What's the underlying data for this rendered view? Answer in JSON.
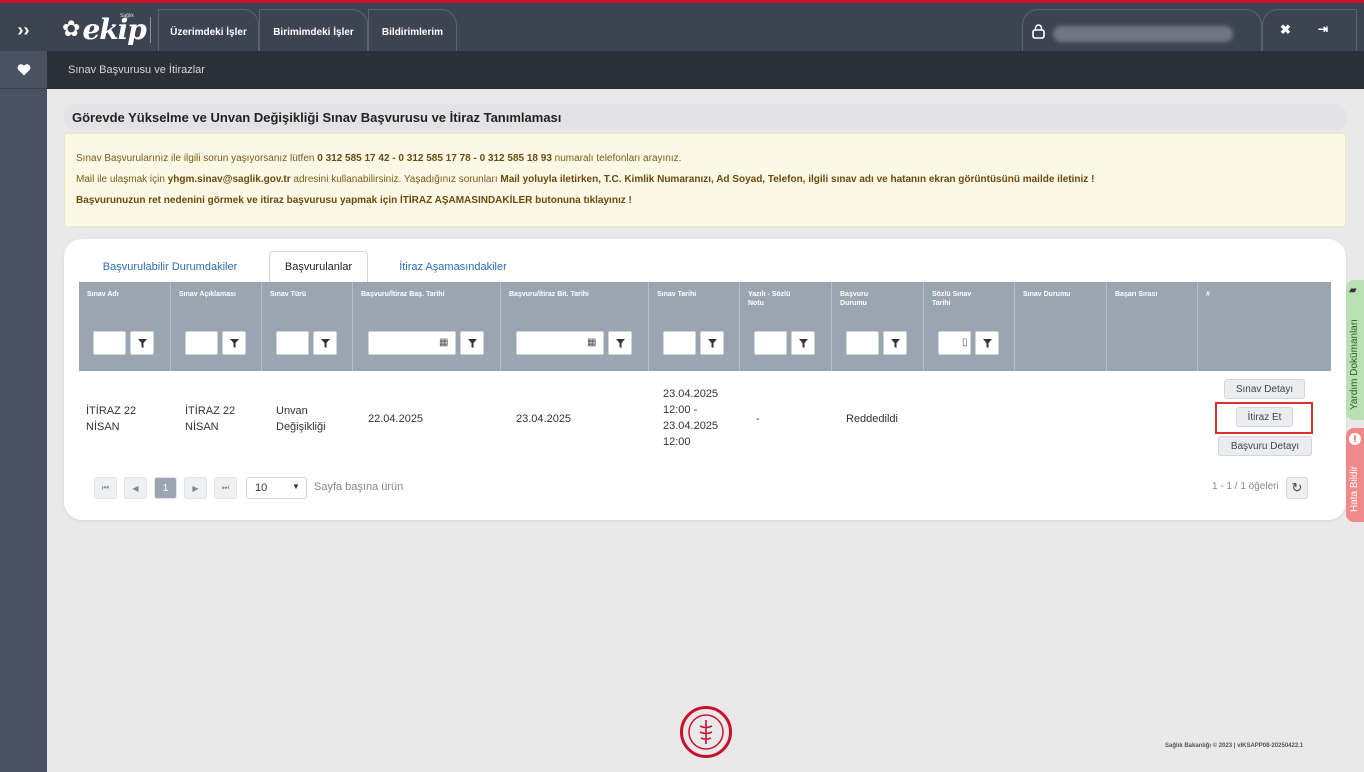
{
  "topbar": {
    "logo_text": "ekip",
    "logo_sub": "Sağlık",
    "tabs": [
      "Üzerimdeki İşler",
      "Birimimdeki İşler",
      "Bildirimlerim"
    ]
  },
  "breadcrumb": "Sınav Başvurusu ve İtirazlar",
  "page_title": "Görevde Yükselme ve Unvan Değişikliği Sınav Başvurusu ve İtiraz Tanımlaması",
  "info": {
    "line1_pre": "Sınav Başvurularınız ile ilgili sorun yaşıyorsanız lütfen ",
    "line1_bold": "0 312 585 17 42 - 0 312 585 17 78 - 0 312 585 18 93",
    "line1_post": " numaralı telefonları arayınız.",
    "line2_pre": "Mail ile ulaşmak için ",
    "line2_mail": "yhgm.sinav@saglik.gov.tr",
    "line2_mid": " adresini kullanabilirsiniz. Yaşadığınız sorunları ",
    "line2_bold": "Mail yoluyla iletirken, T.C. Kimlik Numaranızı, Ad Soyad, Telefon, ilgili sınav adı ve hatanın ekran görüntüsünü mailde iletiniz !",
    "line3": "Başvurunuzun ret nedenini görmek ve itiraz başvurusu yapmak için İTİRAZ AŞAMASINDAKİLER butonuna tıklayınız !"
  },
  "tabs": [
    "Başvurulabilir Durumdakiler",
    "Başvurulanlar",
    "İtiraz Aşamasındakiler"
  ],
  "columns": [
    "Sınav Adı",
    "Sınav Açıklaması",
    "Sınav Türü",
    "Başvuru/İtiraz Baş. Tarihi",
    "Başvuru/İtiraz Bit. Tarihi",
    "Sınav Tarihi",
    "Yazılı - Sözlü Notu",
    "Başvuru Durumu",
    "Sözlü Sınav Tarihi",
    "Sınav Durumu",
    "Başarı Sırası",
    "#"
  ],
  "row": {
    "sinav_adi": "İTİRAZ 22 NİSAN",
    "aciklama": "İTİRAZ 22 NİSAN",
    "tur": "Unvan Değişikliği",
    "bas_tarihi": "22.04.2025",
    "bit_tarihi": "23.04.2025",
    "sinav_tarihi": "23.04.2025 12:00 - 23.04.2025 12:00",
    "not": "-",
    "durum": "Reddedildi"
  },
  "actions": [
    "Sınav Detayı",
    "İtiraz Et",
    "Başvuru Detayı"
  ],
  "pager": {
    "page": "1",
    "page_size": "10",
    "per_page_label": "Sayfa başına ürün",
    "summary": "1 - 1 / 1 öğeleri"
  },
  "side_tabs": {
    "help": "Yardım Dokümanları",
    "error": "Hata Bildir"
  },
  "footer": "Sağlık Bakanlığı © 2023 | vIKSAPP08-20250422.1"
}
